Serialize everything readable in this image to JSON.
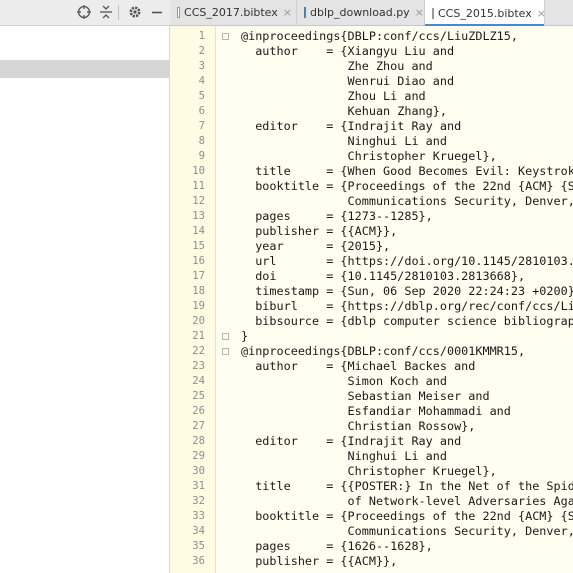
{
  "left_toolbar": {
    "icons": [
      "target-icon",
      "collapse-icon",
      "gear-icon",
      "minimize-icon"
    ]
  },
  "tabs": [
    {
      "label": "CCS_2017.bibtex",
      "close": "×",
      "active": false,
      "icon": "bibtex-file-icon"
    },
    {
      "label": "dblp_download.py",
      "close": "×",
      "active": false,
      "icon": "python-file-icon"
    },
    {
      "label": "CCS_2015.bibtex",
      "close": "×",
      "active": true,
      "icon": "bibtex-file-icon"
    }
  ],
  "editor": {
    "line_numbers": [
      "1",
      "2",
      "3",
      "4",
      "5",
      "6",
      "7",
      "8",
      "9",
      "10",
      "11",
      "12",
      "13",
      "14",
      "15",
      "16",
      "17",
      "18",
      "19",
      "20",
      "21",
      "22",
      "23",
      "24",
      "25",
      "26",
      "27",
      "28",
      "29",
      "30",
      "31",
      "32",
      "33",
      "34",
      "35",
      "36"
    ],
    "lines": [
      "@inproceedings{DBLP:conf/ccs/LiuZDLZ15,",
      "  author    = {Xiangyu Liu and",
      "               Zhe Zhou and",
      "               Wenrui Diao and",
      "               Zhou Li and",
      "               Kehuan Zhang},",
      "  editor    = {Indrajit Ray and",
      "               Ninghui Li and",
      "               Christopher Kruegel},",
      "  title     = {When Good Becomes Evil: Keystrok",
      "  booktitle = {Proceedings of the 22nd {ACM} {S",
      "               Communications Security, Denver,",
      "  pages     = {1273--1285},",
      "  publisher = {{ACM}},",
      "  year      = {2015},",
      "  url       = {https://doi.org/10.1145/2810103.",
      "  doi       = {10.1145/2810103.2813668},",
      "  timestamp = {Sun, 06 Sep 2020 22:24:23 +0200}",
      "  biburl    = {https://dblp.org/rec/conf/ccs/Li",
      "  bibsource = {dblp computer science bibliograp",
      "}",
      "@inproceedings{DBLP:conf/ccs/0001KMMR15,",
      "  author    = {Michael Backes and",
      "               Simon Koch and",
      "               Sebastian Meiser and",
      "               Esfandiar Mohammadi and",
      "               Christian Rossow},",
      "  editor    = {Indrajit Ray and",
      "               Ninghui Li and",
      "               Christopher Kruegel},",
      "  title     = {{POSTER:} In the Net of the Spid",
      "               of Network-level Adversaries Aga",
      "  booktitle = {Proceedings of the 22nd {ACM} {S",
      "               Communications Security, Denver,",
      "  pages     = {1626--1628},",
      "  publisher = {{ACM}},"
    ]
  },
  "colors": {
    "editor_bg": "#fffdf0",
    "gutter_bg": "#fffce4",
    "active_tab_accent": "#4a88c7",
    "selected_row": "#d6d6d6"
  }
}
